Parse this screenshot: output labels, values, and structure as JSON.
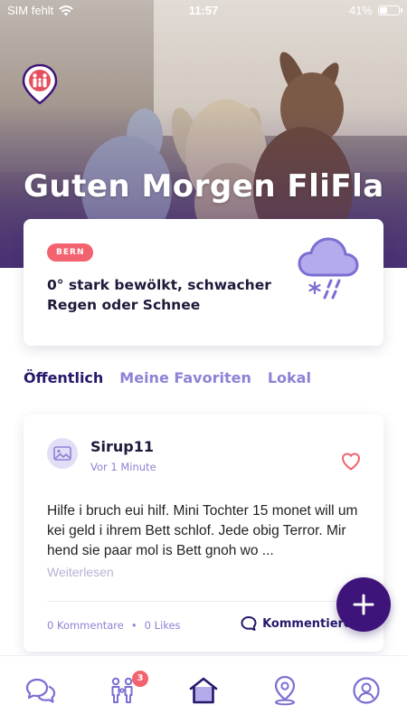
{
  "status_bar": {
    "carrier": "SIM fehlt",
    "time": "11:57",
    "battery": "41%",
    "battery_level": 0.41,
    "wifi_icon": "wifi-icon",
    "battery_icon": "battery-icon"
  },
  "header": {
    "logo_icon": "family-map-pin-icon",
    "greeting": "Guten Morgen FliFla"
  },
  "weather": {
    "location": "BERN",
    "description": "0° stark bewölkt, schwacher Regen oder Schnee",
    "icon": "cloud-snow-rain-icon"
  },
  "tabs": [
    {
      "label": "Öffentlich",
      "active": true
    },
    {
      "label": "Meine Favoriten",
      "active": false
    },
    {
      "label": "Lokal",
      "active": false
    }
  ],
  "post": {
    "author": "Sirup11",
    "time": "Vor 1 Minute",
    "body": "Hilfe i bruch eui hilf. Mini Tochter 15 monet will um kei geld i ihrem Bett schlof. Jede obig Terror. Mir hend sie paar mol is Bett gnoh wo ...",
    "read_more": "Weiterlesen",
    "comments": "0 Kommentare",
    "separator": "•",
    "likes": "0 Likes",
    "comment_action": "Kommentieren"
  },
  "fab": {
    "icon": "plus-icon"
  },
  "bottom_nav": {
    "items": [
      {
        "name": "chat",
        "icon": "chat-bubbles-icon"
      },
      {
        "name": "family",
        "icon": "family-icon",
        "badge": "3"
      },
      {
        "name": "home",
        "icon": "home-icon",
        "active": true
      },
      {
        "name": "map",
        "icon": "map-pin-icon"
      },
      {
        "name": "profile",
        "icon": "profile-icon"
      }
    ]
  },
  "colors": {
    "primary": "#24196b",
    "accent": "#8b83d6",
    "badge": "#f2636f",
    "fab": "#3e147a"
  }
}
